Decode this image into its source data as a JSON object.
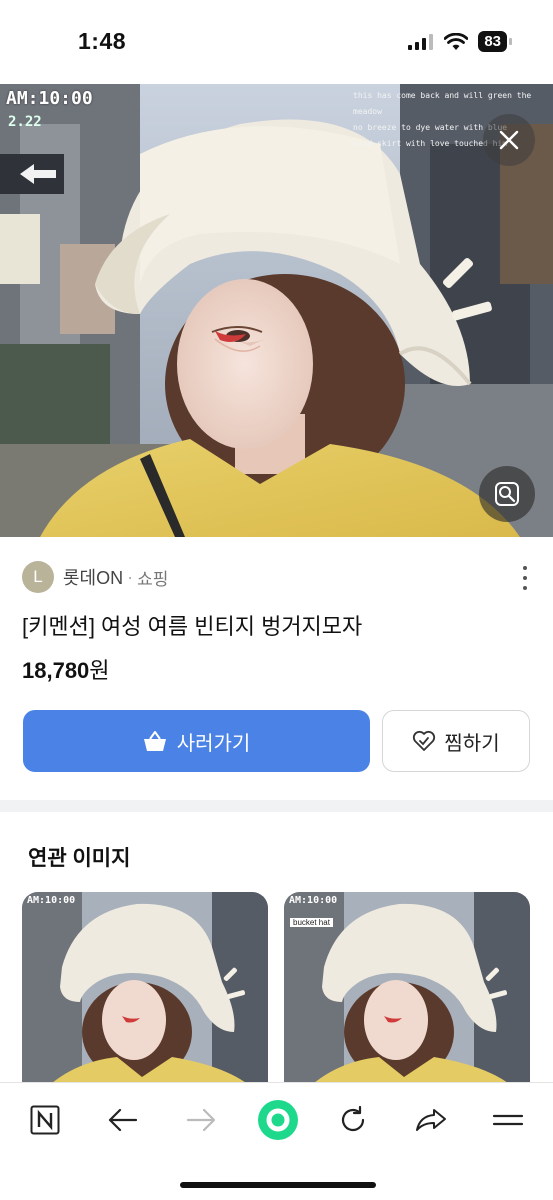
{
  "status_bar": {
    "time": "1:48",
    "battery": "83"
  },
  "hero": {
    "overlay_time": "AM:10:00",
    "overlay_date": "2.22",
    "caption_lines": [
      "this has come back and will green the meadow",
      "no breeze to dye water with blue",
      "wind skirt with love touched him"
    ]
  },
  "store": {
    "logo_letter": "L",
    "name": "롯데ON",
    "separator": "·",
    "type": "쇼핑"
  },
  "product": {
    "title": "[키멘션] 여성 여름 빈티지 벙거지모자",
    "price": "18,780",
    "currency": "원"
  },
  "actions": {
    "buy_label": "사러가기",
    "wish_label": "찜하기"
  },
  "related": {
    "title": "연관 이미지",
    "items": [
      {
        "overlay_time": "AM:10:00",
        "tag": ""
      },
      {
        "overlay_time": "AM:10:00",
        "tag": "bucket hat"
      }
    ]
  },
  "colors": {
    "primary": "#4a82e6",
    "brand_logo": "#b9b39a",
    "accent_green": "#1ed98c"
  }
}
